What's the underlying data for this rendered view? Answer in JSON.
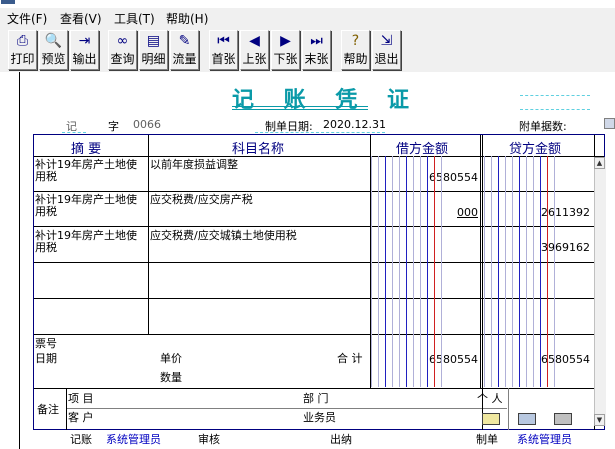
{
  "menu": {
    "file": "文件(F)",
    "view": "查看(V)",
    "tools": "工具(T)",
    "help": "帮助(H)"
  },
  "toolbar": [
    {
      "label": "打印",
      "icon": "printer-icon"
    },
    {
      "label": "预览",
      "icon": "preview-icon"
    },
    {
      "label": "输出",
      "icon": "export-icon"
    },
    {
      "label": "查询",
      "icon": "binoculars-icon"
    },
    {
      "label": "明细",
      "icon": "detail-icon"
    },
    {
      "label": "流量",
      "icon": "flow-icon"
    },
    {
      "label": "首张",
      "icon": "first-icon"
    },
    {
      "label": "上张",
      "icon": "prev-icon"
    },
    {
      "label": "下张",
      "icon": "next-icon"
    },
    {
      "label": "末张",
      "icon": "last-icon"
    },
    {
      "label": "帮助",
      "icon": "help-icon"
    },
    {
      "label": "退出",
      "icon": "exit-icon"
    }
  ],
  "voucher": {
    "title": "记 账 凭 证",
    "type_label": "记",
    "zi_label": "字",
    "number": "0066",
    "date_label": "制单日期:",
    "date": "2020.12.31",
    "attachments_label": "附单据数:"
  },
  "columns": {
    "summary": "摘 要",
    "account": "科目名称",
    "debit": "借方金额",
    "credit": "贷方金额"
  },
  "rows": [
    {
      "summary": "补计19年房产土地使用税",
      "account": "以前年度损益调整",
      "debit": "6580554",
      "credit": ""
    },
    {
      "summary": "补计19年房产土地使用税",
      "account": "应交税费/应交房产税",
      "debit": "000",
      "credit": "2611392"
    },
    {
      "summary": "补计19年房产土地使用税",
      "account": "应交税费/应交城镇土地使用税",
      "debit": "",
      "credit": "3969162"
    },
    {
      "summary": "",
      "account": "",
      "debit": "",
      "credit": ""
    },
    {
      "summary": "",
      "account": "",
      "debit": "",
      "credit": ""
    }
  ],
  "totals": {
    "ticket_label": "票号",
    "date_label": "日期",
    "price_label": "单价",
    "qty_label": "数量",
    "total_label": "合 计",
    "debit_total": "6580554",
    "credit_total": "6580554"
  },
  "remarks": {
    "label": "备注",
    "project_label": "项 目",
    "customer_label": "客 户",
    "dept_label": "部 门",
    "person_label": "个 人",
    "salesman_label": "业务员"
  },
  "footer": {
    "posted_label": "记账",
    "posted_by": "系统管理员",
    "review_label": "审核",
    "cashier_label": "出纳",
    "maker_label": "制单",
    "maker": "系统管理员"
  },
  "colors": {
    "title": "#0a9aa8",
    "header_text": "#000080",
    "grid_blue": "#2020c0",
    "grid_red": "#d02020",
    "name_blue": "#0000c0"
  }
}
